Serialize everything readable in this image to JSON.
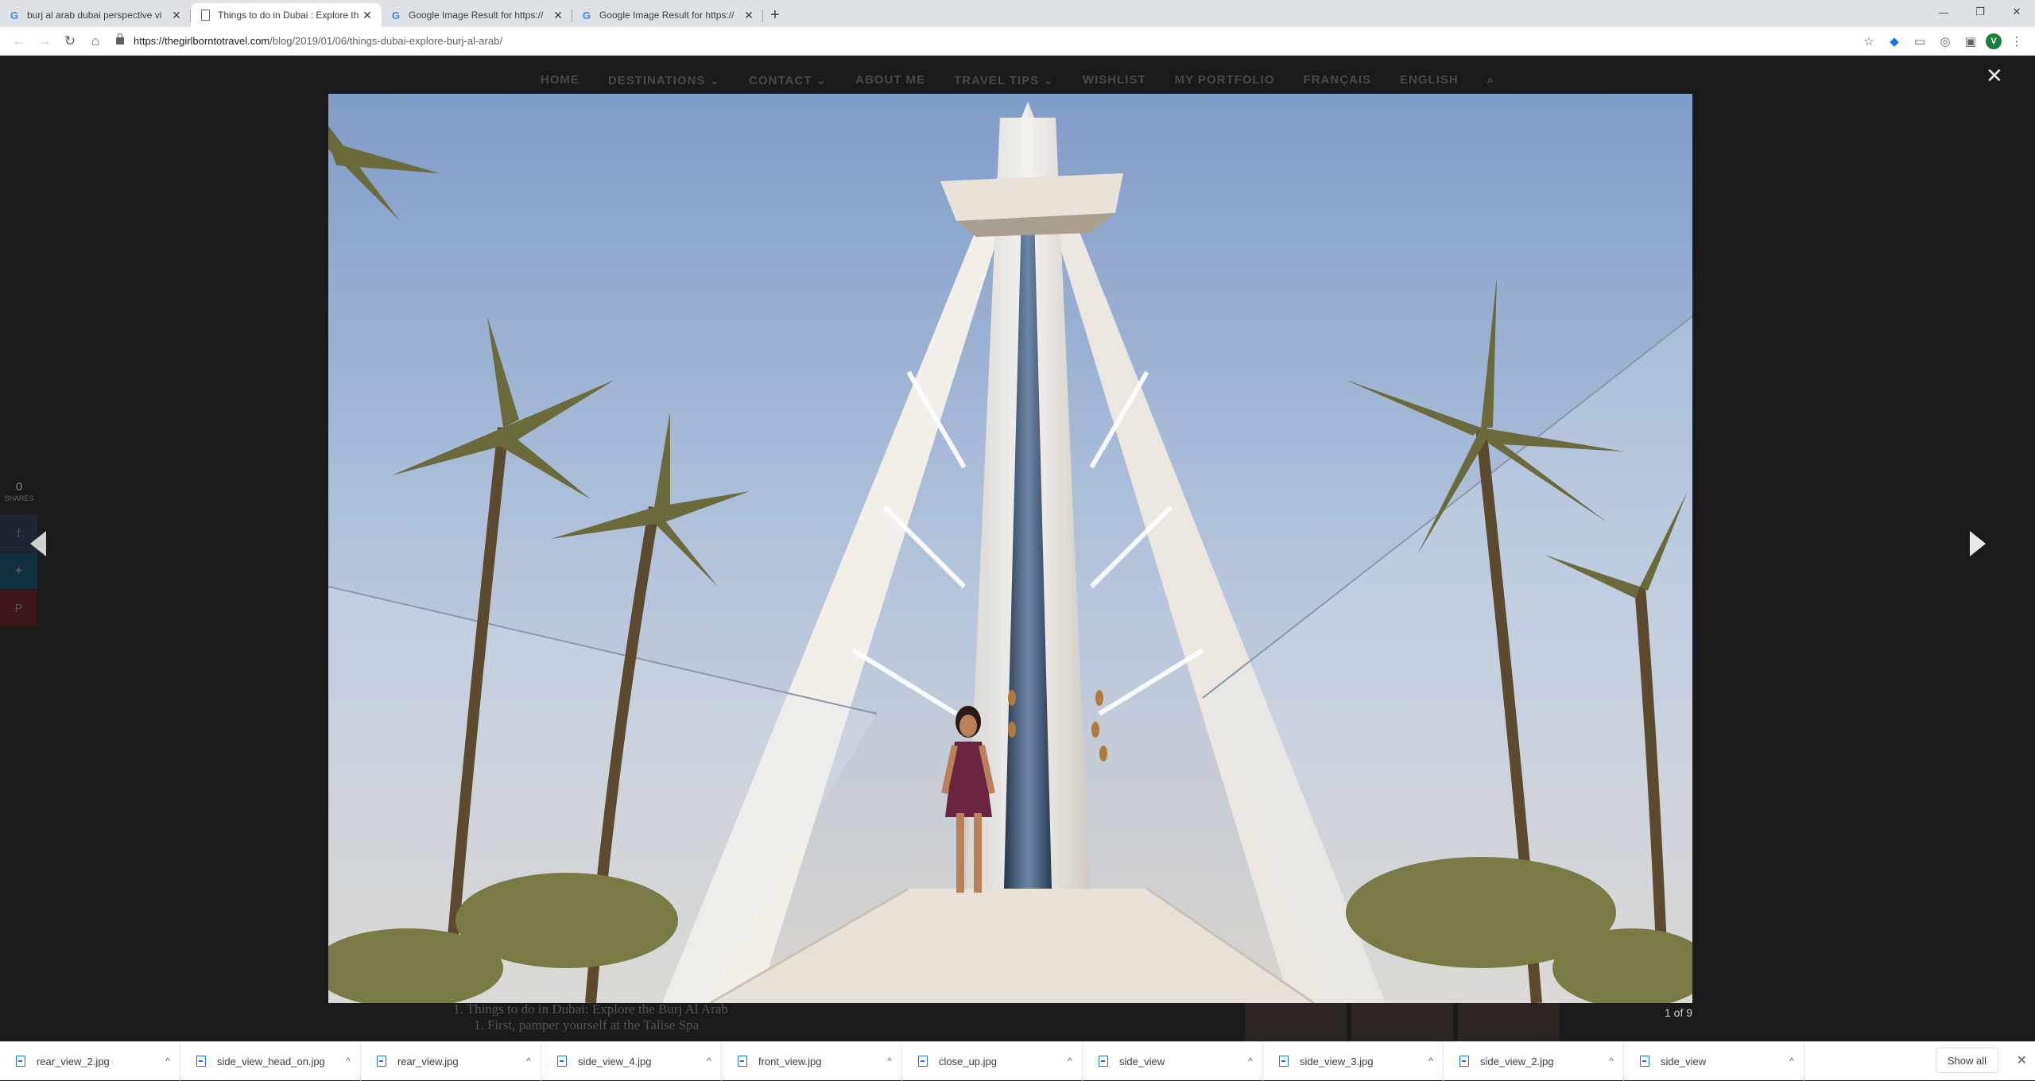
{
  "browser": {
    "tabs": [
      {
        "title": "burj al arab dubai perspective vi",
        "icon": "google-g-icon",
        "active": false
      },
      {
        "title": "Things to do in Dubai : Explore th",
        "icon": "page-doc-icon",
        "active": true
      },
      {
        "title": "Google Image Result for https://",
        "icon": "google-g-icon",
        "active": false
      },
      {
        "title": "Google Image Result for https://",
        "icon": "google-g-icon",
        "active": false
      }
    ],
    "url_host": "https://thegirlborntotravel.com",
    "url_path": "/blog/2019/01/06/things-dubai-explore-burj-al-arab/",
    "avatar_letter": "V"
  },
  "site_nav": {
    "items": [
      "HOME",
      "DESTINATIONS ⌄",
      "CONTACT ⌄",
      "ABOUT ME",
      "TRAVEL TIPS ⌄",
      "WISHLIST",
      "MY PORTFOLIO",
      "FRANÇAIS",
      "ENGLISH"
    ]
  },
  "share": {
    "count": "0",
    "label": "SHARES"
  },
  "article": {
    "line1": "1. Things to do in Dubai: Explore the Burj Al Arab",
    "line2": "1. First, pamper yourself at the Talise Spa"
  },
  "lightbox": {
    "counter": "1 of 9",
    "close": "✕"
  },
  "downloads": {
    "items": [
      "rear_view_2.jpg",
      "side_view_head_on.jpg",
      "rear_view.jpg",
      "side_view_4.jpg",
      "front_view.jpg",
      "close_up.jpg",
      "side_view",
      "side_view_3.jpg",
      "side_view_2.jpg",
      "side_view"
    ],
    "show_all": "Show all"
  }
}
